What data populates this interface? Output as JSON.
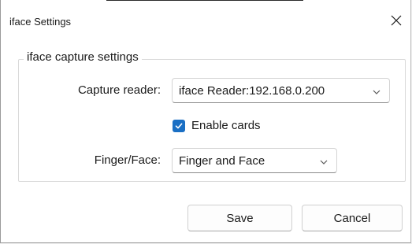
{
  "window": {
    "title": "iface Settings"
  },
  "group": {
    "legend": "iface capture settings"
  },
  "capture_reader": {
    "label": "Capture reader:",
    "value": "iface Reader:192.168.0.200"
  },
  "enable_cards": {
    "label": "Enable cards",
    "checked": true
  },
  "finger_face": {
    "label": "Finger/Face:",
    "value": "Finger and Face"
  },
  "buttons": {
    "save": "Save",
    "cancel": "Cancel"
  },
  "colors": {
    "accent": "#1a6fc4",
    "window_bg": "#ffffff"
  },
  "icons": {
    "close": "close-icon",
    "dropdown": "chevron-down-icon",
    "check": "checkmark-icon"
  }
}
